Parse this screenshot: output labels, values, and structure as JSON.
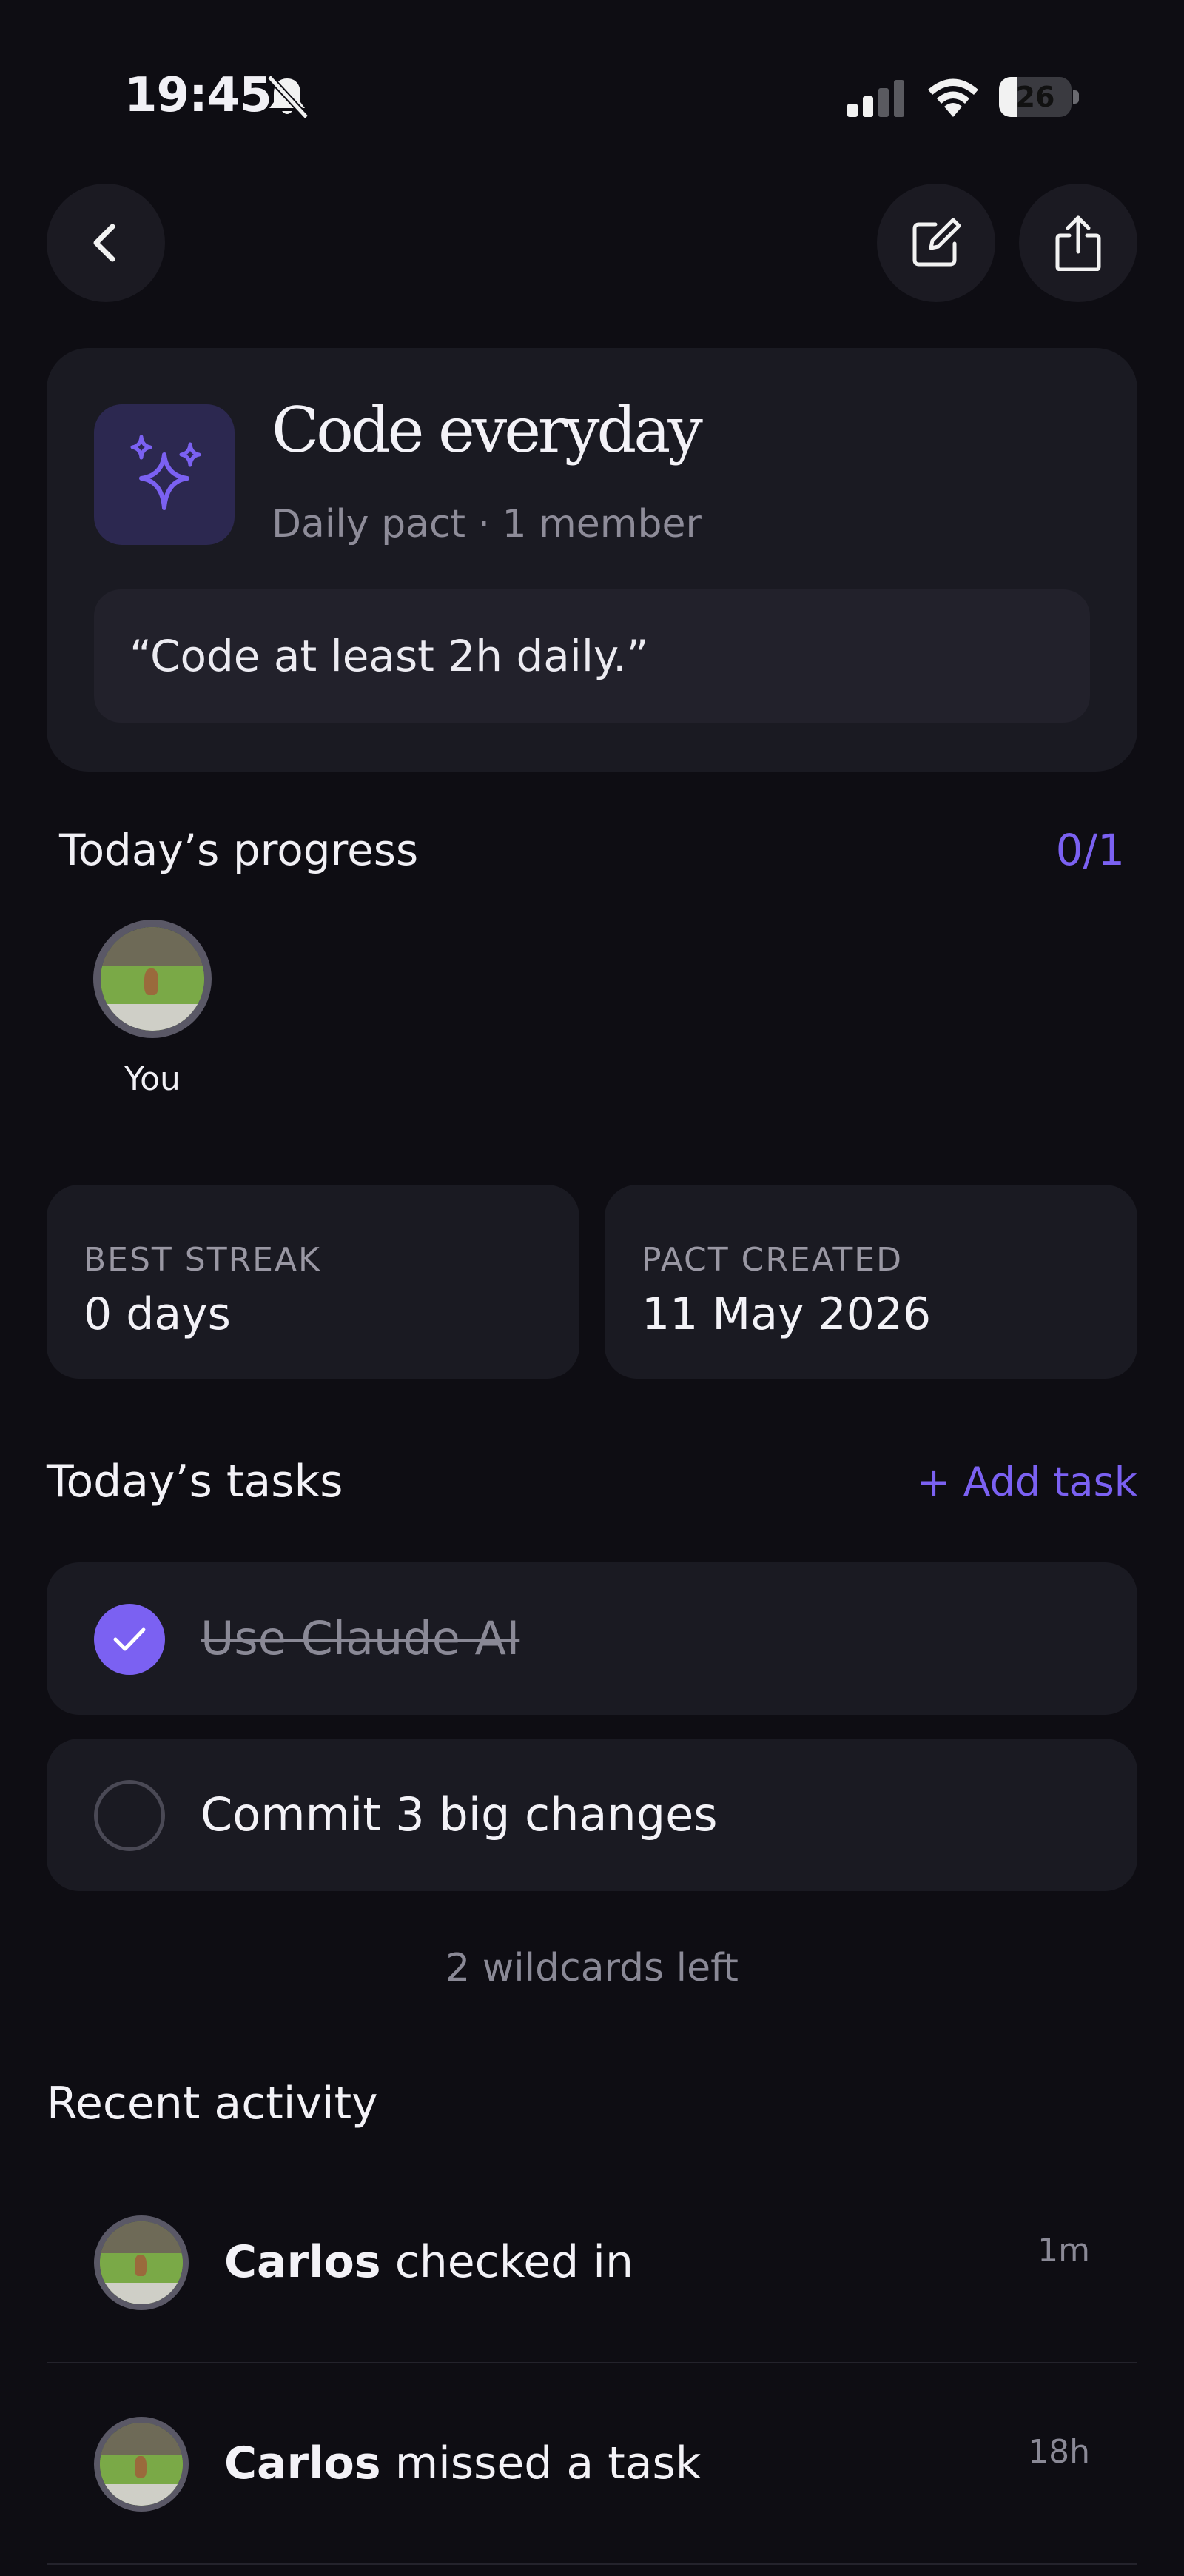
{
  "status_bar": {
    "time": "19:45",
    "battery": "26",
    "battery_level": 0.26,
    "icons": [
      "bell-slash-icon",
      "signal-icon",
      "wifi-icon",
      "battery-icon"
    ]
  },
  "nav": {
    "back_icon": "chevron-left-icon",
    "edit_icon": "edit-icon",
    "share_icon": "share-icon"
  },
  "pact": {
    "icon": "sparkles-icon",
    "title": "Code everyday",
    "subtitle": "Daily pact · 1 member",
    "quote": "“Code at least 2h daily.”"
  },
  "progress": {
    "title": "Today’s progress",
    "count": "0/1",
    "members": [
      {
        "label": "You"
      }
    ]
  },
  "stats": {
    "best_streak_label": "BEST STREAK",
    "best_streak_value": "0 days",
    "created_label": "PACT CREATED",
    "created_value": "11 May 2026"
  },
  "tasks": {
    "title": "Today’s tasks",
    "add_label": "+ Add task",
    "items": [
      {
        "label": "Use Claude AI",
        "done": true
      },
      {
        "label": "Commit 3 big changes",
        "done": false
      }
    ],
    "wildcards": "2 wildcards left"
  },
  "activity": {
    "title": "Recent activity",
    "items": [
      {
        "name": "Carlos",
        "action": "checked in",
        "time": "1m"
      },
      {
        "name": "Carlos",
        "action": "missed a task",
        "time": "18h"
      }
    ]
  },
  "colors": {
    "accent": "#7b61f2",
    "background": "#0e0d13",
    "card": "#1a1a22"
  }
}
